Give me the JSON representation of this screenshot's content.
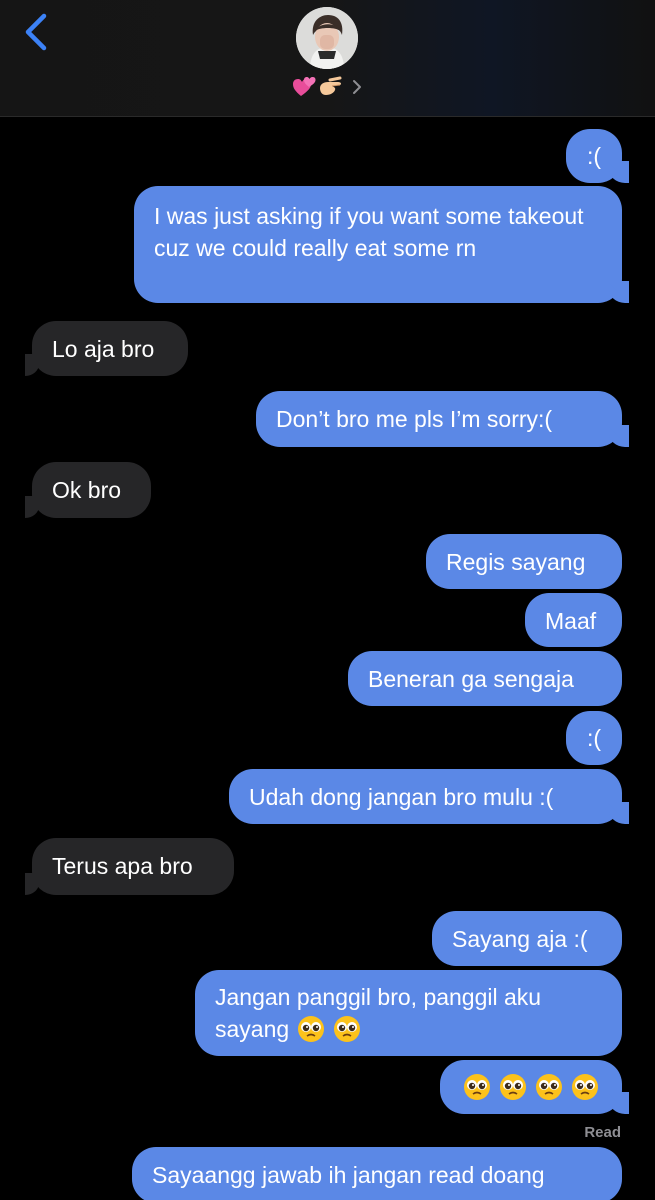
{
  "header": {
    "back_icon": "chevron-left-icon",
    "avatar_icon": "contact-avatar",
    "contact_name_emojis": [
      "two-hearts-emoji",
      "pinching-hand-emoji"
    ],
    "chevron_icon": "chevron-right-icon"
  },
  "colors": {
    "sent_bubble": "#5b88e6",
    "received_bubble": "#262628",
    "background": "#000000",
    "back_arrow": "#3c82f6",
    "read_receipt": "#8e8e93"
  },
  "messages": [
    {
      "from": "me",
      "text": ":("
    },
    {
      "from": "me",
      "text": "I was just asking if you want some takeout cuz we could really eat some rn"
    },
    {
      "from": "them",
      "text": "Lo aja bro"
    },
    {
      "from": "me",
      "text": "Don’t bro me pls I’m sorry:("
    },
    {
      "from": "them",
      "text": "Ok bro"
    },
    {
      "from": "me",
      "text": "Regis sayang"
    },
    {
      "from": "me",
      "text": "Maaf"
    },
    {
      "from": "me",
      "text": "Beneran ga sengaja"
    },
    {
      "from": "me",
      "text": ":("
    },
    {
      "from": "me",
      "text": "Udah dong jangan bro mulu :("
    },
    {
      "from": "them",
      "text": "Terus apa bro"
    },
    {
      "from": "me",
      "text": "Sayang aja :("
    },
    {
      "from": "me",
      "text": "Jangan panggil bro, panggil aku",
      "text_line2": "sayang",
      "emoji_count": 2
    },
    {
      "from": "me",
      "emoji_only": true,
      "emoji_count": 4
    },
    {
      "from": "me",
      "text": "Sayaangg jawab ih jangan read doang"
    }
  ],
  "read_receipt": "Read"
}
